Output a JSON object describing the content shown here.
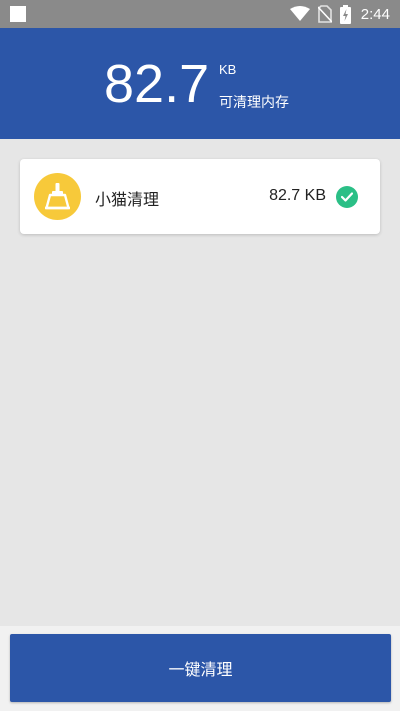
{
  "status_bar": {
    "time": "2:44",
    "icons": [
      "notification-square-icon",
      "wifi-icon",
      "no-sim-icon",
      "battery-charging-icon"
    ]
  },
  "header": {
    "size_value": "82.7",
    "size_unit": "KB",
    "subtitle": "可清理内存"
  },
  "list": {
    "items": [
      {
        "name": "小猫清理",
        "size": "82.7 KB",
        "icon": "broom-icon",
        "checked": true
      }
    ]
  },
  "actions": {
    "clean_label": "一键清理"
  },
  "colors": {
    "primary": "#2c56a8",
    "status_bar": "#8a8a8a",
    "background": "#e6e6e6",
    "icon_yellow": "#f7c93a",
    "check_green": "#2bbf86"
  }
}
